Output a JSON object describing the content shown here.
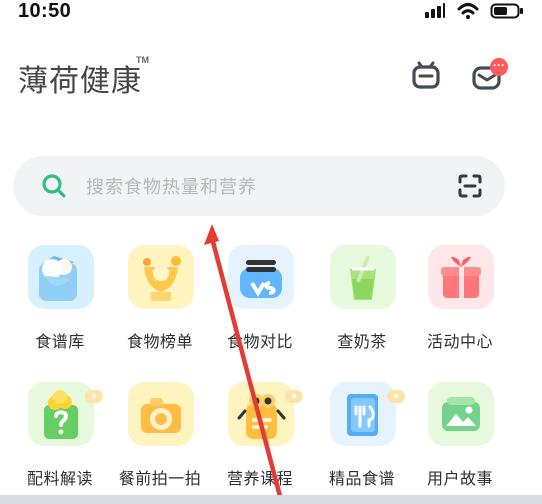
{
  "status_bar": {
    "time": "10:50",
    "icons": [
      "signal-icon",
      "wifi-icon",
      "battery-icon"
    ]
  },
  "header": {
    "logo_text": "薄荷健康",
    "trademark": "TM",
    "calendar_icon": "calendar-icon",
    "message_icon": "message-icon",
    "notification_text": "···"
  },
  "search": {
    "placeholder": "搜索食物热量和营养",
    "search_icon": "search-icon",
    "scan_icon": "scan-icon"
  },
  "features": [
    {
      "label": "食谱库",
      "icon": "recipe-library-icon",
      "color": "#d6f0ff"
    },
    {
      "label": "食物榜单",
      "icon": "food-ranking-icon",
      "color": "#fff3bf"
    },
    {
      "label": "食物对比",
      "icon": "food-compare-icon",
      "color": "#e5f2ff"
    },
    {
      "label": "查奶茶",
      "icon": "milk-tea-icon",
      "color": "#e6f9dc"
    },
    {
      "label": "活动中心",
      "icon": "activity-center-icon",
      "color": "#ffe6e8"
    },
    {
      "label": "配料解读",
      "icon": "ingredient-reading-icon",
      "color": "#e6f9dc"
    },
    {
      "label": "餐前拍一拍",
      "icon": "camera-before-meal-icon",
      "color": "#fff3bf"
    },
    {
      "label": "营养课程",
      "icon": "nutrition-course-icon",
      "color": "#fff3bf"
    },
    {
      "label": "精品食谱",
      "icon": "premium-recipe-icon",
      "color": "#e5f2ff"
    },
    {
      "label": "用户故事",
      "icon": "user-story-icon",
      "color": "#e6f9dc"
    }
  ],
  "colors": {
    "accent": "#2fbf86",
    "arrow": "#e53b34",
    "badge": "#ff5b59",
    "search_background": "#f1f3f5"
  }
}
